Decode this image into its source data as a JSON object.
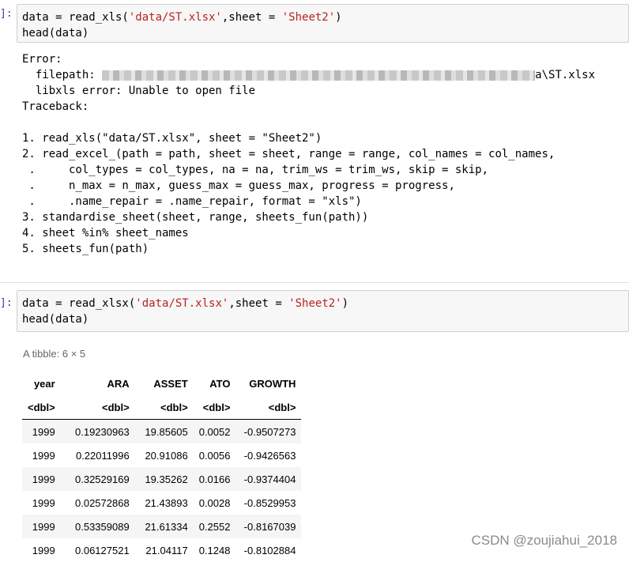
{
  "cell1": {
    "prompt": "]:",
    "code": {
      "l1_a": "data = read_xls(",
      "l1_str1": "'data/ST.xlsx'",
      "l1_b": ",sheet = ",
      "l1_str2": "'Sheet2'",
      "l1_c": ")",
      "l2": "head(data)"
    },
    "output": {
      "error": "Error:",
      "filepath_label": "  filepath: ",
      "filepath_tail": "a\\ST.xlsx",
      "libxls": "  libxls error: Unable to open file",
      "traceback": "Traceback:",
      "blank": " ",
      "t1": "1. read_xls(\"data/ST.xlsx\", sheet = \"Sheet2\")",
      "t2": "2. read_excel_(path = path, sheet = sheet, range = range, col_names = col_names,",
      "t2a": " .     col_types = col_types, na = na, trim_ws = trim_ws, skip = skip,",
      "t2b": " .     n_max = n_max, guess_max = guess_max, progress = progress,",
      "t2c": " .     .name_repair = .name_repair, format = \"xls\")",
      "t3": "3. standardise_sheet(sheet, range, sheets_fun(path))",
      "t4": "4. sheet %in% sheet_names",
      "t5": "5. sheets_fun(path)"
    }
  },
  "cell2": {
    "prompt": "]:",
    "code": {
      "l1_a": "data = read_xlsx(",
      "l1_str1": "'data/ST.xlsx'",
      "l1_b": ",sheet = ",
      "l1_str2": "'Sheet2'",
      "l1_c": ")",
      "l2": "head(data)"
    }
  },
  "tibble": {
    "caption": "A tibble: 6 × 5",
    "columns": [
      "year",
      "ARA",
      "ASSET",
      "ATO",
      "GROWTH"
    ],
    "types": [
      "<dbl>",
      "<dbl>",
      "<dbl>",
      "<dbl>",
      "<dbl>"
    ],
    "rows": [
      [
        "1999",
        "0.19230963",
        "19.85605",
        "0.0052",
        "-0.9507273"
      ],
      [
        "1999",
        "0.22011996",
        "20.91086",
        "0.0056",
        "-0.9426563"
      ],
      [
        "1999",
        "0.32529169",
        "19.35262",
        "0.0166",
        "-0.9374404"
      ],
      [
        "1999",
        "0.02572868",
        "21.43893",
        "0.0028",
        "-0.8529953"
      ],
      [
        "1999",
        "0.53359089",
        "21.61334",
        "0.2552",
        "-0.8167039"
      ],
      [
        "1999",
        "0.06127521",
        "21.04117",
        "0.1248",
        "-0.8102884"
      ]
    ]
  },
  "watermark": "CSDN @zoujiahui_2018"
}
